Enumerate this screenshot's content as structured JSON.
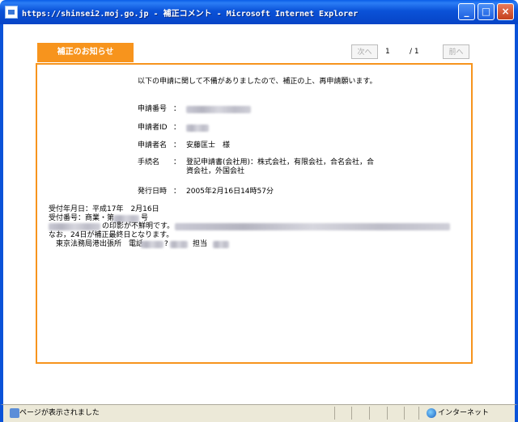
{
  "window": {
    "title": "https://shinsei2.moj.go.jp - 補正コメント - Microsoft Internet Explorer",
    "min_glyph": "_",
    "max_glyph": "□",
    "close_glyph": "×"
  },
  "tab": {
    "label": "補正のお知らせ"
  },
  "pager": {
    "next_label": "次へ",
    "current": "1",
    "total": "/ 1",
    "prev_label": "前へ"
  },
  "notice": {
    "intro": "以下の申請に関して不備がありましたので、補正の上、再申請願います。",
    "fields": [
      {
        "label": "申請番号",
        "colon": "：",
        "value": ""
      },
      {
        "label": "申請者ID",
        "colon": "：",
        "value": ""
      },
      {
        "label": "申請者名",
        "colon": "：",
        "value": "安藤匡士　様"
      },
      {
        "label": "手続名",
        "colon": "：",
        "value_line1": "登記申請書(会社用)：株式会社，有限会社，合名会社，合",
        "value_line2": "資会社，外国会社"
      },
      {
        "label": "発行日時",
        "colon": "：",
        "value": "2005年2月16日14時57分"
      }
    ],
    "comment": {
      "line1": "受付年月日：平成17年　2月16日",
      "line2_a": "受付番号：商業・第",
      "line2_b": "号",
      "line3": "の印影が不鮮明です。",
      "line4": "なお，24日が補正最終日となります。",
      "line5_a": "　東京法務局港出張所　電話",
      "line5_b": "?",
      "line5_c": "担当"
    }
  },
  "status": {
    "text": "ページが表示されました",
    "zone": "インターネット"
  },
  "colors": {
    "accent": "#f7941d",
    "titlebar": "#0a52d8"
  }
}
